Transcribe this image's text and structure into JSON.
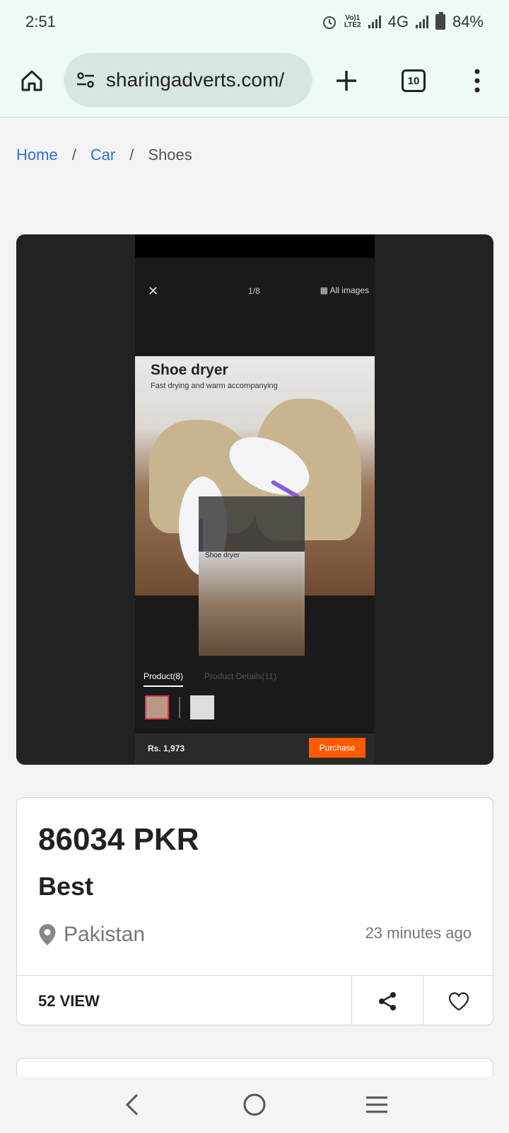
{
  "status": {
    "time": "2:51",
    "volte": "VoLTE2",
    "network": "4G",
    "battery": "84%"
  },
  "browser": {
    "url": "sharingadverts.com/",
    "tab_count": "10"
  },
  "breadcrumb": {
    "home": "Home",
    "sep": "/",
    "category": "Car",
    "current": "Shoes"
  },
  "viewer": {
    "counter": "1/8",
    "all_images": "All images",
    "image_title": "Shoe dryer",
    "image_subtitle": "Fast drying and warm accompanying",
    "inner_title": "Shoe dryer",
    "tab_product": "Product(8)",
    "tab_details": "Product Details(11)",
    "price": "Rs. 1,973",
    "purchase": "Purchase"
  },
  "listing": {
    "price": "86034 PKR",
    "title": "Best",
    "location": "Pakistan",
    "posted": "23 minutes ago",
    "views": "52 VIEW"
  }
}
